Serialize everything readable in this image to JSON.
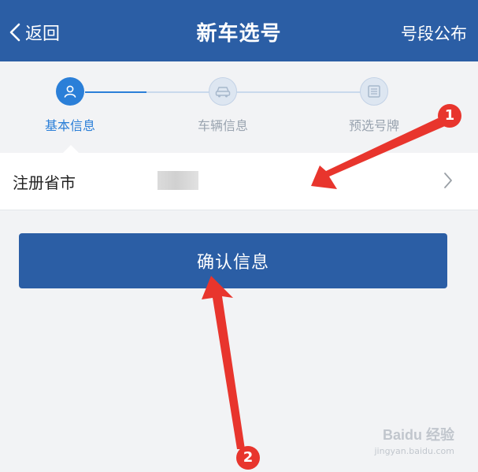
{
  "header": {
    "back_label": "返回",
    "title": "新车选号",
    "right_action": "号段公布"
  },
  "stepper": {
    "steps": [
      {
        "label": "基本信息",
        "state": "active",
        "icon": "person-icon"
      },
      {
        "label": "车辆信息",
        "state": "inactive",
        "icon": "car-icon"
      },
      {
        "label": "预选号牌",
        "state": "inactive",
        "icon": "plate-icon"
      }
    ]
  },
  "form": {
    "region_label": "注册省市"
  },
  "confirm_label": "确认信息",
  "annotations": {
    "badge_1": "1",
    "badge_2": "2"
  },
  "watermark": {
    "logo": "Baidu 经验",
    "url": "jingyan.baidu.com"
  },
  "colors": {
    "primary": "#2b5ea5",
    "accent": "#2b7fd8",
    "annotation": "#e8352d"
  }
}
